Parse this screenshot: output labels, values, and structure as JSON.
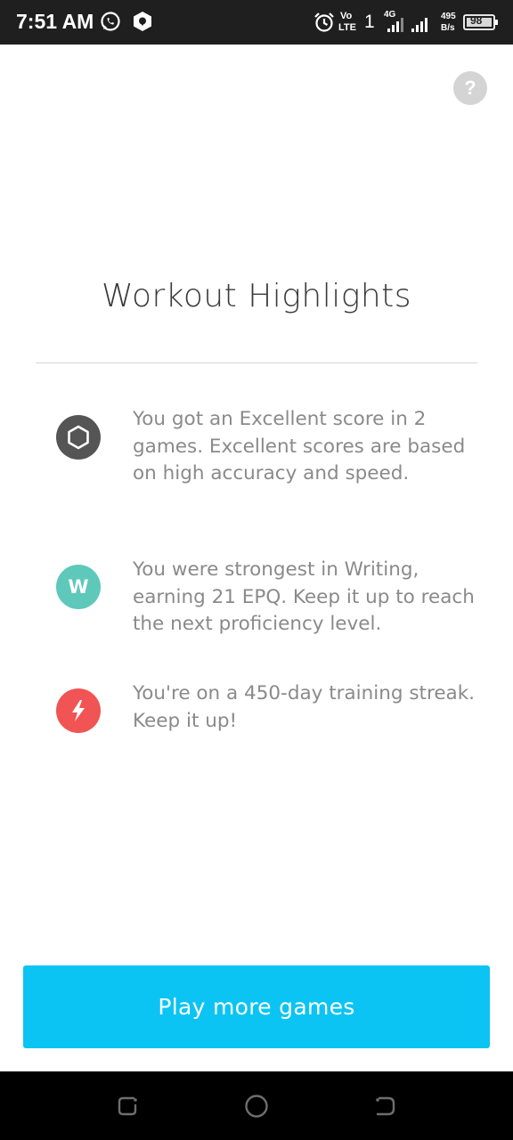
{
  "status_bar": {
    "time": "7:51 AM",
    "network_vo": "Vo",
    "network_lte": "LTE",
    "sim_slot": "1",
    "network_4g": "4G",
    "speed_value": "495",
    "speed_unit": "B/s",
    "battery": "98",
    "icons": [
      "whatsapp-icon",
      "shield-app-icon",
      "alarm-icon",
      "signal-icon",
      "battery-icon"
    ]
  },
  "help": {
    "label": "?"
  },
  "title": "Workout Highlights",
  "highlights": [
    {
      "icon": "hexagon-icon",
      "icon_color": "#555555",
      "text": "You got an Excellent score in 2 games. Excellent scores are based on high accuracy and speed."
    },
    {
      "icon": "writing-icon",
      "icon_letter": "W",
      "icon_color": "#5ec8bb",
      "text": "You were strongest in Writing, earning 21 EPQ. Keep it up to reach the next proficiency level."
    },
    {
      "icon": "lightning-icon",
      "icon_color": "#f15454",
      "text": "You're on a 450-day training streak. Keep it up!"
    }
  ],
  "cta": {
    "label": "Play more games",
    "color": "#0bc4f4"
  },
  "nav": {
    "buttons": [
      "recents-button",
      "home-button",
      "back-button"
    ]
  }
}
